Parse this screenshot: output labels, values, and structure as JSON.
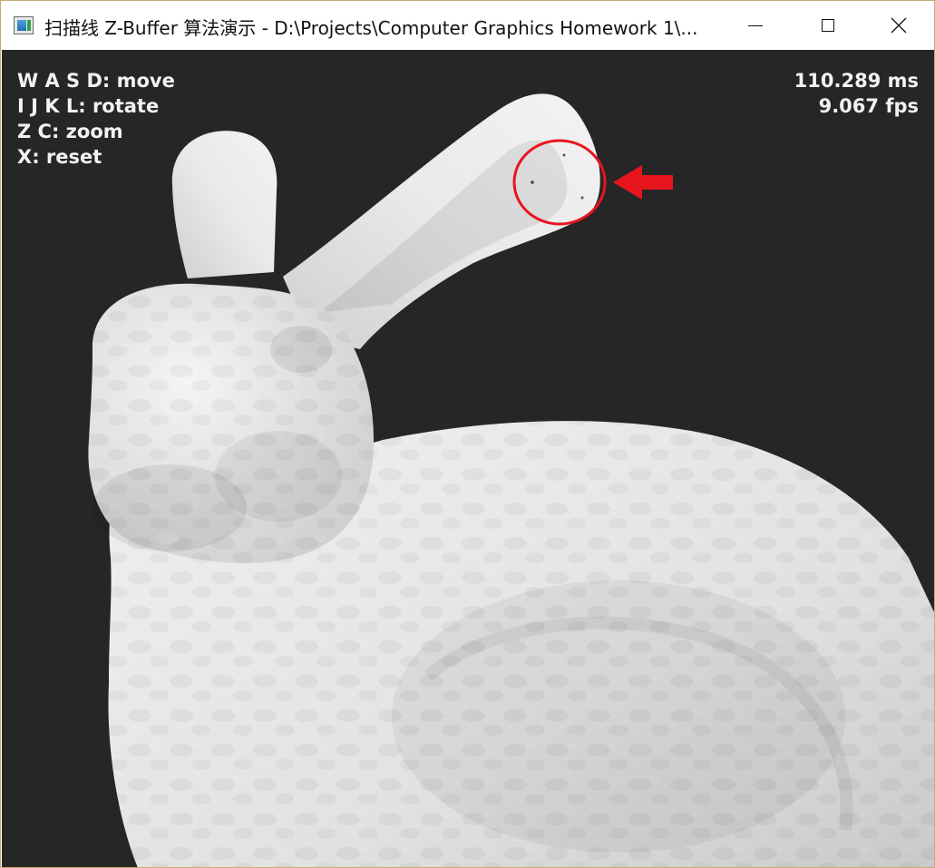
{
  "window": {
    "title": "扫描线 Z-Buffer 算法演示 - D:\\Projects\\Computer Graphics Homework 1\\...",
    "icon": "app-window-icon",
    "controls": [
      "minimize-icon",
      "maximize-icon",
      "close-icon"
    ]
  },
  "hud": {
    "controls": [
      {
        "keys": "W A S D",
        "action": "move"
      },
      {
        "keys": "I J K L",
        "action": "rotate"
      },
      {
        "keys": "Z C",
        "action": "zoom"
      },
      {
        "keys": "X",
        "action": "reset"
      }
    ],
    "frame_time": "110.289 ms",
    "fps": "9.067 fps"
  },
  "colors": {
    "background": "#262626",
    "model": "#e6e6e6",
    "annotation": "#e8141e"
  }
}
